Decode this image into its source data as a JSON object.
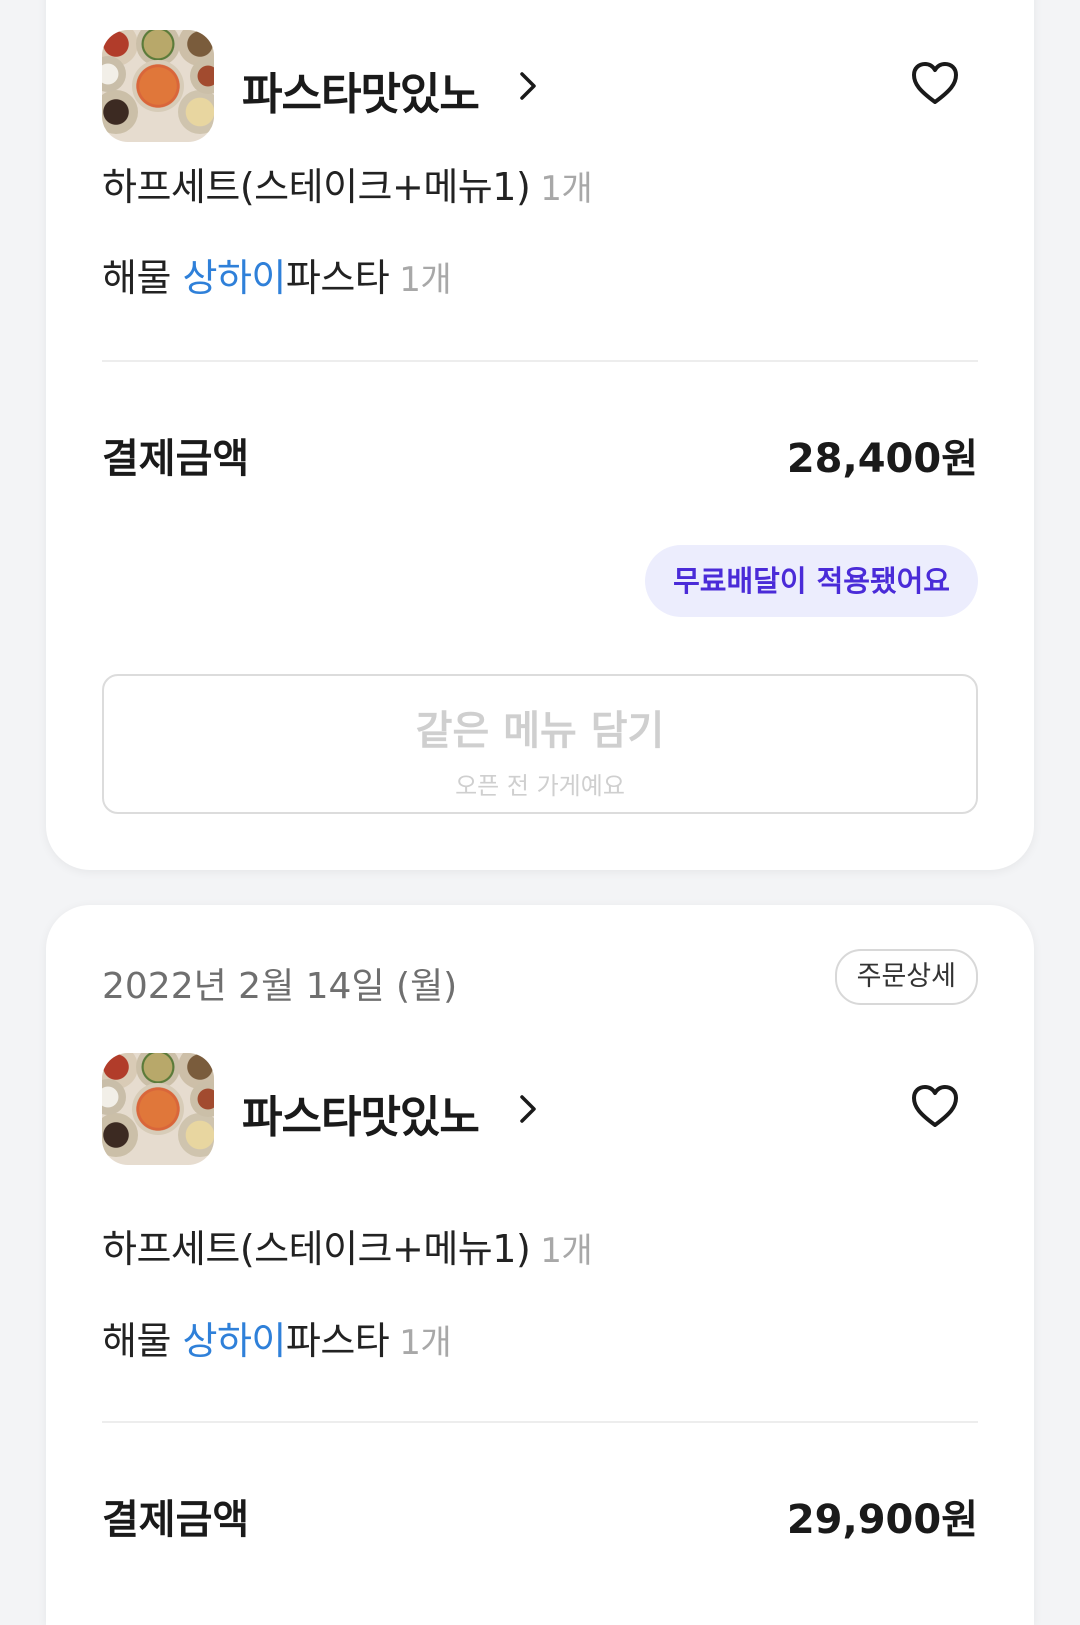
{
  "orders": [
    {
      "store_name": "파스타맛있노",
      "items": [
        {
          "name": "하프세트(스테이크+메뉴1)",
          "qty": "1개"
        },
        {
          "name_prefix": "해물 ",
          "name_highlight": "상하이",
          "name_suffix": "파스타",
          "qty": "1개"
        }
      ],
      "payment_label": "결제금액",
      "payment_amount": "28,400원",
      "free_delivery_badge": "무료배달이 적용됐어요",
      "reorder_button": {
        "label": "같은 메뉴 담기",
        "sublabel": "오픈 전 가게예요"
      }
    },
    {
      "date": "2022년 2월 14일 (월)",
      "detail_button": "주문상세",
      "store_name": "파스타맛있노",
      "items": [
        {
          "name": "하프세트(스테이크+메뉴1)",
          "qty": "1개"
        },
        {
          "name_prefix": "해물 ",
          "name_highlight": "상하이",
          "name_suffix": "파스타",
          "qty": "1개"
        }
      ],
      "payment_label": "결제금액",
      "payment_amount": "29,900원"
    }
  ],
  "colors": {
    "highlight": "#2f80d9",
    "badge_bg": "#ecedfd",
    "badge_text": "#4a2bd8",
    "disabled_text": "#cfcfcf"
  },
  "icons": {
    "store_chevron": "chevron-right-icon",
    "favorite": "heart-outline-icon",
    "thumbnail": "store-thumbnail"
  }
}
